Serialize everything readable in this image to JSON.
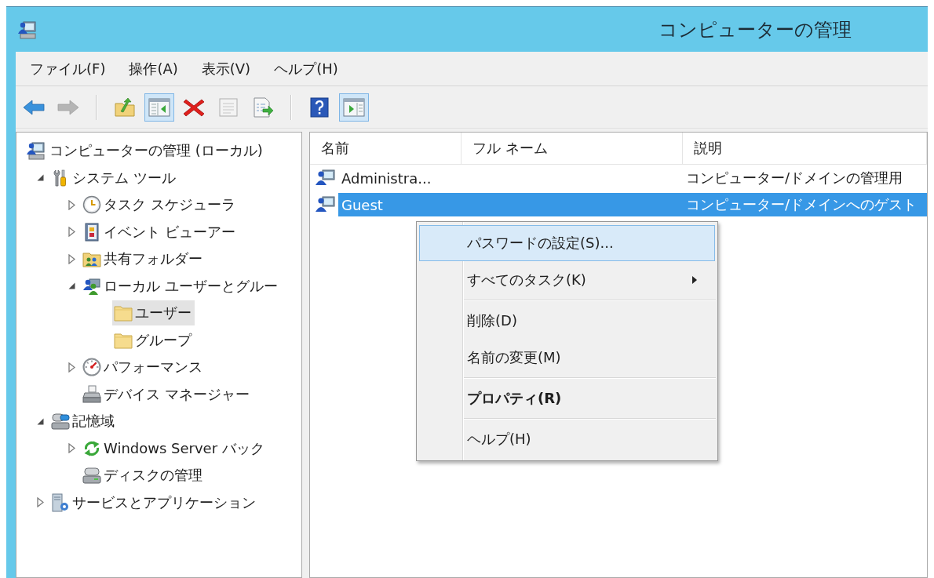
{
  "window": {
    "title": "コンピューターの管理"
  },
  "menu_bar": [
    "ファイル(F)",
    "操作(A)",
    "表示(V)",
    "ヘルプ(H)"
  ],
  "toolbar": [
    {
      "kind": "button",
      "pressed": false,
      "disabled": false
    },
    {
      "kind": "button",
      "pressed": false,
      "disabled": true
    },
    {
      "kind": "separator"
    },
    {
      "kind": "button",
      "pressed": false,
      "disabled": false
    },
    {
      "kind": "button",
      "pressed": true,
      "disabled": false
    },
    {
      "kind": "button",
      "pressed": false,
      "disabled": false
    },
    {
      "kind": "button",
      "pressed": false,
      "disabled": true
    },
    {
      "kind": "button",
      "pressed": false,
      "disabled": false
    },
    {
      "kind": "separator"
    },
    {
      "kind": "button",
      "pressed": false,
      "disabled": false
    },
    {
      "kind": "button",
      "pressed": true,
      "disabled": false
    }
  ],
  "tree": {
    "items": [
      {
        "label": "コンピューターの管理 (ローカル)",
        "selected": false,
        "children": [
          {
            "label": "システム ツール",
            "selected": false,
            "expanded": true,
            "children": [
              {
                "label": "タスク スケジューラ",
                "selected": false,
                "expanded": false
              },
              {
                "label": "イベント ビューアー",
                "selected": false,
                "expanded": false
              },
              {
                "label": "共有フォルダー",
                "selected": false,
                "expanded": false
              },
              {
                "label": "ローカル ユーザーとグルー",
                "selected": false,
                "expanded": true,
                "children": [
                  {
                    "label": "ユーザー",
                    "selected": true
                  },
                  {
                    "label": "グループ",
                    "selected": false
                  }
                ]
              },
              {
                "label": "パフォーマンス",
                "selected": false,
                "expanded": false
              },
              {
                "label": "デバイス マネージャー",
                "selected": false
              }
            ]
          },
          {
            "label": "記憶域",
            "selected": false,
            "expanded": true,
            "children": [
              {
                "label": "Windows Server バック",
                "selected": false,
                "expanded": false
              },
              {
                "label": "ディスクの管理",
                "selected": false
              }
            ]
          },
          {
            "label": "サービスとアプリケーション",
            "selected": false,
            "expanded": false
          }
        ]
      }
    ]
  },
  "table": {
    "columns": [
      "名前",
      "フル ネーム",
      "説明"
    ],
    "rows": [
      {
        "name": "Administra...",
        "description": "コンピューター/ドメインの管理用",
        "selected": false
      },
      {
        "name": "Guest",
        "description": "コンピューター/ドメインへのゲスト",
        "selected": true
      }
    ]
  },
  "context_menu": {
    "items": [
      {
        "kind": "item",
        "label": "パスワードの設定(S)...",
        "selected": true,
        "default": false,
        "submenu": false
      },
      {
        "kind": "item",
        "label": "すべてのタスク(K)",
        "selected": false,
        "default": false,
        "submenu": true
      },
      {
        "kind": "separator"
      },
      {
        "kind": "item",
        "label": "削除(D)",
        "selected": false,
        "default": false,
        "submenu": false
      },
      {
        "kind": "item",
        "label": "名前の変更(M)",
        "selected": false,
        "default": false,
        "submenu": false
      },
      {
        "kind": "separator"
      },
      {
        "kind": "item",
        "label": "プロパティ(R)",
        "selected": false,
        "default": true,
        "submenu": false
      },
      {
        "kind": "separator"
      },
      {
        "kind": "item",
        "label": "ヘルプ(H)",
        "selected": false,
        "default": false,
        "submenu": false
      }
    ]
  }
}
